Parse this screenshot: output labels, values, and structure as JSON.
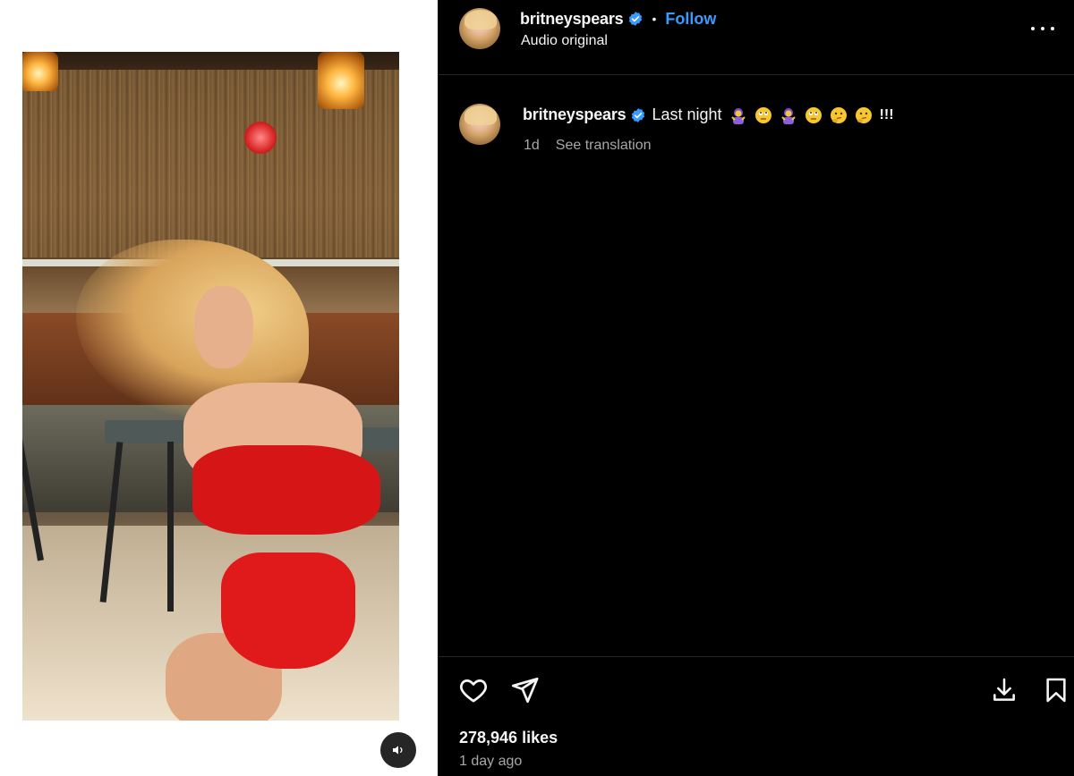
{
  "post": {
    "username": "britneyspears",
    "separator": "•",
    "follow_label": "Follow",
    "audio_label": "Audio original"
  },
  "caption": {
    "username": "britneyspears",
    "text": "Last night",
    "emojis": [
      "woman-gesturing-no-emoji",
      "rolling-eyes-emoji",
      "woman-gesturing-no-emoji",
      "rolling-eyes-emoji",
      "thinking-emoji",
      "thinking-emoji"
    ],
    "exclamation": "!!!",
    "age": "1d",
    "translate_label": "See translation"
  },
  "footer": {
    "likes": "278,946 likes",
    "posted_ago": "1 day ago"
  },
  "colors": {
    "accent": "#3a9bff",
    "verified": "#3a9bff",
    "background": "#000000",
    "divider": "#262626",
    "secondary_text": "#a8a8a8"
  },
  "icons": {
    "mute": "speaker-icon",
    "more": "more-options-icon",
    "like": "heart-icon",
    "share": "paper-plane-icon",
    "download": "download-icon",
    "save": "bookmark-icon",
    "verified": "verified-badge-icon"
  }
}
